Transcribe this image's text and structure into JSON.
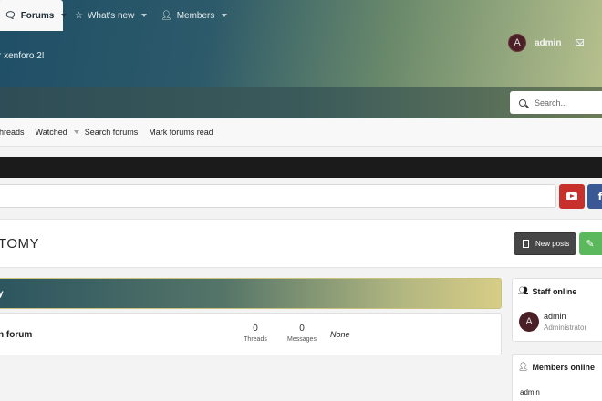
{
  "header": {
    "tagline": "r xenforo 2!",
    "user": {
      "avatar_letter": "A",
      "name": "admin"
    }
  },
  "nav": {
    "tabs": [
      {
        "label": "Forums",
        "active": true
      },
      {
        "label": "What's new",
        "active": false
      },
      {
        "label": "Members",
        "active": false
      }
    ],
    "search_placeholder": "Search..."
  },
  "subnav": {
    "items": [
      "hreads",
      "Watched",
      "Search forums",
      "Mark forums read"
    ]
  },
  "page": {
    "title": "TOMY",
    "new_posts_button": "New posts"
  },
  "category": {
    "title": "y",
    "forums": [
      {
        "name": "n forum",
        "threads": "0",
        "threads_label": "Threads",
        "messages": "0",
        "messages_label": "Messages",
        "last_post": "None"
      }
    ]
  },
  "sidebar": {
    "staff_online": {
      "title": "Staff online",
      "members": [
        {
          "avatar_letter": "A",
          "name": "admin",
          "role": "Administrator"
        }
      ]
    },
    "members_online": {
      "title": "Members online",
      "members": [
        "admin"
      ]
    }
  },
  "colors": {
    "youtube": "#c8302b",
    "facebook": "#3a5893",
    "post_button": "#5cb85c",
    "avatar_bg": "#4a1f26"
  }
}
